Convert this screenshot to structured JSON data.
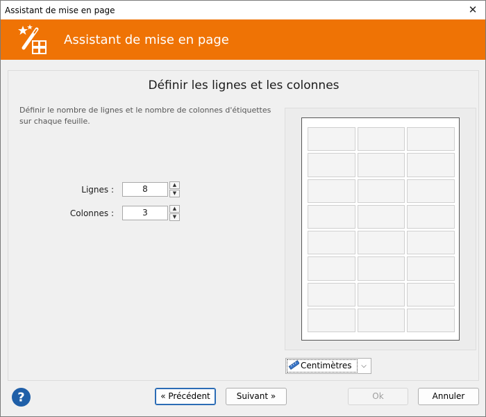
{
  "window": {
    "title": "Assistant de mise en page",
    "close_glyph": "✕"
  },
  "banner": {
    "title": "Assistant de mise en page",
    "icon": "magic-wand-icon",
    "color": "#ef7305"
  },
  "step": {
    "title": "Définir les lignes et les colonnes",
    "description": "Définir le nombre de lignes et le nombre de colonnes d'étiquettes sur chaque feuille."
  },
  "fields": {
    "rows_label": "Lignes :",
    "rows_value": "8",
    "columns_label": "Colonnes :",
    "columns_value": "3"
  },
  "preview": {
    "rows": 8,
    "columns": 3
  },
  "unit": {
    "selected": "Centimètres",
    "icon": "ruler-icon"
  },
  "buttons": {
    "previous": "« Précédent",
    "next": "Suivant »",
    "ok": "Ok",
    "cancel": "Annuler"
  },
  "help": {
    "icon": "help-icon",
    "glyph": "?",
    "color": "#1f5fa8"
  }
}
